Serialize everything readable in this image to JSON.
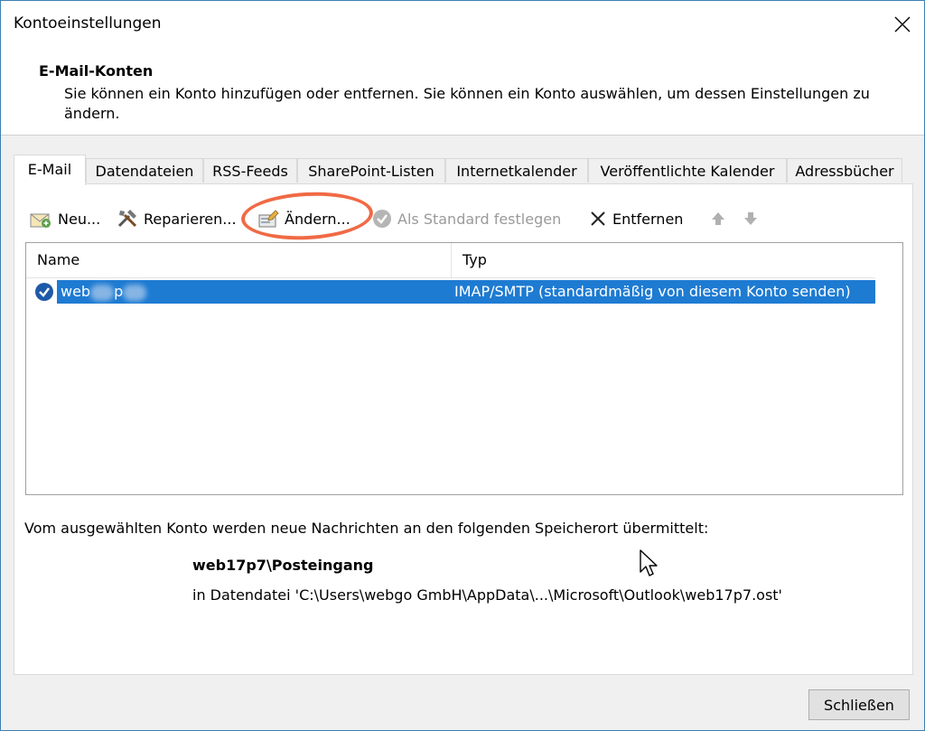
{
  "window": {
    "title": "Kontoeinstellungen"
  },
  "header": {
    "title": "E-Mail-Konten",
    "description": "Sie können ein Konto hinzufügen oder entfernen. Sie können ein Konto auswählen, um dessen Einstellungen zu ändern."
  },
  "tabs": [
    "E-Mail",
    "Datendateien",
    "RSS-Feeds",
    "SharePoint-Listen",
    "Internetkalender",
    "Veröffentlichte Kalender",
    "Adressbücher"
  ],
  "toolbar": {
    "new_label": "Neu...",
    "repair_label": "Reparieren...",
    "change_label": "Ändern...",
    "default_label": "Als Standard festlegen",
    "remove_label": "Entfernen"
  },
  "list": {
    "columns": [
      "Name",
      "Typ"
    ],
    "rows": [
      {
        "name_start": "web",
        "name_end": "p",
        "type": "IMAP/SMTP (standardmäßig von diesem Konto senden)"
      }
    ]
  },
  "delivery": {
    "intro": "Vom ausgewählten Konto werden neue Nachrichten an den folgenden Speicherort übermittelt:",
    "folder": "web17p7\\Posteingang",
    "file": "in Datendatei 'C:\\Users\\webgo GmbH\\AppData\\...\\Microsoft\\Outlook\\web17p7.ost'"
  },
  "footer": {
    "close_label": "Schließen"
  },
  "colors": {
    "selection": "#1e7bd2",
    "highlight": "#f06a45",
    "border_accent": "#3c7fb1"
  }
}
